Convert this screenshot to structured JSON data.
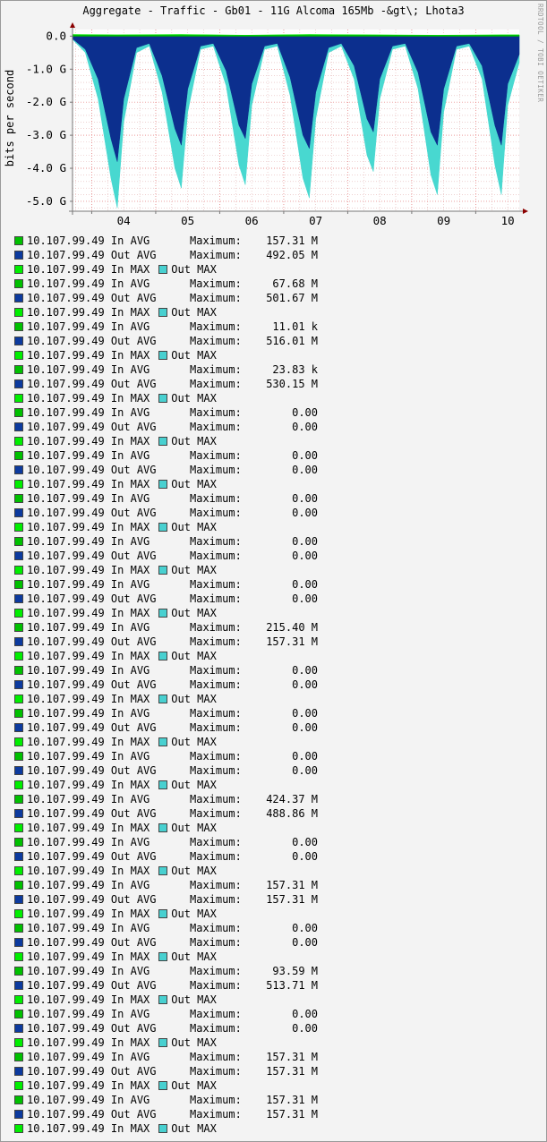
{
  "title": "Aggregate - Traffic - Gb01 - 11G Alcoma 165Mb -&gt\\; Lhota3",
  "watermark": "RRDTOOL / TOBI OETIKER",
  "chart_data": {
    "type": "area",
    "title": "Aggregate - Traffic - Gb01 - 11G Alcoma 165Mb -&gt\\; Lhota3",
    "ylabel": "bits per second",
    "xlabel": "",
    "x_ticks": [
      "04",
      "05",
      "06",
      "07",
      "08",
      "09",
      "10"
    ],
    "y_ticks": [
      "0.0",
      "-1.0 G",
      "-2.0 G",
      "-3.0 G",
      "-4.0 G",
      "-5.0 G"
    ],
    "y_tick_values": [
      0,
      -1.0,
      -2.0,
      -3.0,
      -4.0,
      -5.0
    ],
    "ylim": [
      -5.3,
      0.2
    ],
    "y_units": "Gbit/s",
    "grid": true,
    "x_start_day": 3.7,
    "x_end_day": 10.68,
    "series": [
      {
        "name": "Out MAX",
        "color": "#48d8d0",
        "x": [
          3.7,
          3.9,
          4.1,
          4.3,
          4.4,
          4.5,
          4.7,
          4.9,
          5.1,
          5.3,
          5.4,
          5.5,
          5.7,
          5.9,
          6.1,
          6.3,
          6.4,
          6.5,
          6.7,
          6.9,
          7.1,
          7.3,
          7.4,
          7.5,
          7.7,
          7.9,
          8.1,
          8.3,
          8.4,
          8.5,
          8.7,
          8.9,
          9.1,
          9.3,
          9.4,
          9.5,
          9.7,
          9.9,
          10.1,
          10.3,
          10.4,
          10.5,
          10.68
        ],
        "y": [
          -0.1,
          -0.5,
          -1.9,
          -4.3,
          -5.2,
          -2.6,
          -0.5,
          -0.3,
          -1.7,
          -4.0,
          -4.6,
          -2.3,
          -0.4,
          -0.3,
          -1.5,
          -3.9,
          -4.5,
          -2.1,
          -0.4,
          -0.3,
          -1.8,
          -4.3,
          -4.9,
          -2.5,
          -0.5,
          -0.3,
          -1.3,
          -3.6,
          -4.1,
          -1.9,
          -0.4,
          -0.3,
          -1.6,
          -4.2,
          -4.8,
          -2.3,
          -0.4,
          -0.3,
          -1.3,
          -3.9,
          -4.8,
          -2.1,
          -0.8
        ]
      },
      {
        "name": "Out AVG",
        "color": "#0c2f8e",
        "x": [
          3.7,
          3.9,
          4.1,
          4.3,
          4.4,
          4.5,
          4.7,
          4.9,
          5.1,
          5.3,
          5.4,
          5.5,
          5.7,
          5.9,
          6.1,
          6.3,
          6.4,
          6.5,
          6.7,
          6.9,
          7.1,
          7.3,
          7.4,
          7.5,
          7.7,
          7.9,
          8.1,
          8.3,
          8.4,
          8.5,
          8.7,
          8.9,
          9.1,
          9.3,
          9.4,
          9.5,
          9.7,
          9.9,
          10.1,
          10.3,
          10.4,
          10.5,
          10.68
        ],
        "y": [
          -0.08,
          -0.4,
          -1.3,
          -3.1,
          -3.8,
          -1.9,
          -0.35,
          -0.22,
          -1.2,
          -2.8,
          -3.3,
          -1.6,
          -0.3,
          -0.22,
          -1.05,
          -2.7,
          -3.1,
          -1.45,
          -0.3,
          -0.22,
          -1.25,
          -3.0,
          -3.4,
          -1.7,
          -0.35,
          -0.22,
          -0.9,
          -2.5,
          -2.9,
          -1.3,
          -0.3,
          -0.22,
          -1.1,
          -2.9,
          -3.3,
          -1.6,
          -0.3,
          -0.22,
          -0.9,
          -2.7,
          -3.3,
          -1.45,
          -0.55
        ]
      },
      {
        "name": "In MAX",
        "color": "#00e600",
        "x": [
          3.7,
          4.4,
          5.4,
          6.4,
          7.4,
          8.4,
          9.4,
          10.4,
          10.68
        ],
        "y": [
          0.05,
          0.04,
          0.05,
          0.03,
          0.05,
          0.04,
          0.03,
          0.04,
          0.04
        ]
      },
      {
        "name": "In AVG",
        "color": "#00b000",
        "x": [
          3.7,
          4.4,
          5.4,
          6.4,
          7.4,
          8.4,
          9.4,
          10.4,
          10.68
        ],
        "y": [
          0.02,
          0.02,
          0.02,
          0.01,
          0.02,
          0.02,
          0.01,
          0.02,
          0.02
        ]
      }
    ]
  },
  "legend": {
    "colors": {
      "in_avg": "#00c000",
      "out_avg": "#0c3a9e",
      "in_max": "#00ee00",
      "out_max": "#48d0d0"
    },
    "max_label": "Maximum:",
    "out_max_label": "Out MAX",
    "blocks": [
      {
        "in_avg": "10.107.99.49 In AVG",
        "in_max_val": "157.31 M",
        "out_avg": "10.107.99.49 Out AVG",
        "out_max_val": "492.05 M",
        "in_max": "10.107.99.49 In MAX"
      },
      {
        "in_avg": "10.107.99.49 In AVG",
        "in_max_val": "67.68 M",
        "out_avg": "10.107.99.49 Out AVG",
        "out_max_val": "501.67 M",
        "in_max": "10.107.99.49 In MAX"
      },
      {
        "in_avg": "10.107.99.49 In AVG",
        "in_max_val": "11.01 k",
        "out_avg": "10.107.99.49 Out AVG",
        "out_max_val": "516.01 M",
        "in_max": "10.107.99.49 In MAX"
      },
      {
        "in_avg": "10.107.99.49 In AVG",
        "in_max_val": "23.83 k",
        "out_avg": "10.107.99.49 Out AVG",
        "out_max_val": "530.15 M",
        "in_max": "10.107.99.49 In MAX"
      },
      {
        "in_avg": "10.107.99.49 In AVG",
        "in_max_val": "0.00",
        "out_avg": "10.107.99.49 Out AVG",
        "out_max_val": "0.00",
        "in_max": "10.107.99.49 In MAX"
      },
      {
        "in_avg": "10.107.99.49 In AVG",
        "in_max_val": "0.00",
        "out_avg": "10.107.99.49 Out AVG",
        "out_max_val": "0.00",
        "in_max": "10.107.99.49 In MAX"
      },
      {
        "in_avg": "10.107.99.49 In AVG",
        "in_max_val": "0.00",
        "out_avg": "10.107.99.49 Out AVG",
        "out_max_val": "0.00",
        "in_max": "10.107.99.49 In MAX"
      },
      {
        "in_avg": "10.107.99.49 In AVG",
        "in_max_val": "0.00",
        "out_avg": "10.107.99.49 Out AVG",
        "out_max_val": "0.00",
        "in_max": "10.107.99.49 In MAX"
      },
      {
        "in_avg": "10.107.99.49 In AVG",
        "in_max_val": "0.00",
        "out_avg": "10.107.99.49 Out AVG",
        "out_max_val": "0.00",
        "in_max": "10.107.99.49 In MAX"
      },
      {
        "in_avg": "10.107.99.49 In AVG",
        "in_max_val": "215.40 M",
        "out_avg": "10.107.99.49 Out AVG",
        "out_max_val": "157.31 M",
        "in_max": "10.107.99.49 In MAX"
      },
      {
        "in_avg": "10.107.99.49 In AVG",
        "in_max_val": "0.00",
        "out_avg": "10.107.99.49 Out AVG",
        "out_max_val": "0.00",
        "in_max": "10.107.99.49 In MAX"
      },
      {
        "in_avg": "10.107.99.49 In AVG",
        "in_max_val": "0.00",
        "out_avg": "10.107.99.49 Out AVG",
        "out_max_val": "0.00",
        "in_max": "10.107.99.49 In MAX"
      },
      {
        "in_avg": "10.107.99.49 In AVG",
        "in_max_val": "0.00",
        "out_avg": "10.107.99.49 Out AVG",
        "out_max_val": "0.00",
        "in_max": "10.107.99.49 In MAX"
      },
      {
        "in_avg": "10.107.99.49 In AVG",
        "in_max_val": "424.37 M",
        "out_avg": "10.107.99.49 Out AVG",
        "out_max_val": "488.86 M",
        "in_max": "10.107.99.49 In MAX"
      },
      {
        "in_avg": "10.107.99.49 In AVG",
        "in_max_val": "0.00",
        "out_avg": "10.107.99.49 Out AVG",
        "out_max_val": "0.00",
        "in_max": "10.107.99.49 In MAX"
      },
      {
        "in_avg": "10.107.99.49 In AVG",
        "in_max_val": "157.31 M",
        "out_avg": "10.107.99.49 Out AVG",
        "out_max_val": "157.31 M",
        "in_max": "10.107.99.49 In MAX"
      },
      {
        "in_avg": "10.107.99.49 In AVG",
        "in_max_val": "0.00",
        "out_avg": "10.107.99.49 Out AVG",
        "out_max_val": "0.00",
        "in_max": "10.107.99.49 In MAX"
      },
      {
        "in_avg": "10.107.99.49 In AVG",
        "in_max_val": "93.59 M",
        "out_avg": "10.107.99.49 Out AVG",
        "out_max_val": "513.71 M",
        "in_max": "10.107.99.49 In MAX"
      },
      {
        "in_avg": "10.107.99.49 In AVG",
        "in_max_val": "0.00",
        "out_avg": "10.107.99.49 Out AVG",
        "out_max_val": "0.00",
        "in_max": "10.107.99.49 In MAX"
      },
      {
        "in_avg": "10.107.99.49 In AVG",
        "in_max_val": "157.31 M",
        "out_avg": "10.107.99.49 Out AVG",
        "out_max_val": "157.31 M",
        "in_max": "10.107.99.49 In MAX"
      },
      {
        "in_avg": "10.107.99.49 In AVG",
        "in_max_val": "157.31 M",
        "out_avg": "10.107.99.49 Out AVG",
        "out_max_val": "157.31 M",
        "in_max": "10.107.99.49 In MAX"
      }
    ]
  }
}
